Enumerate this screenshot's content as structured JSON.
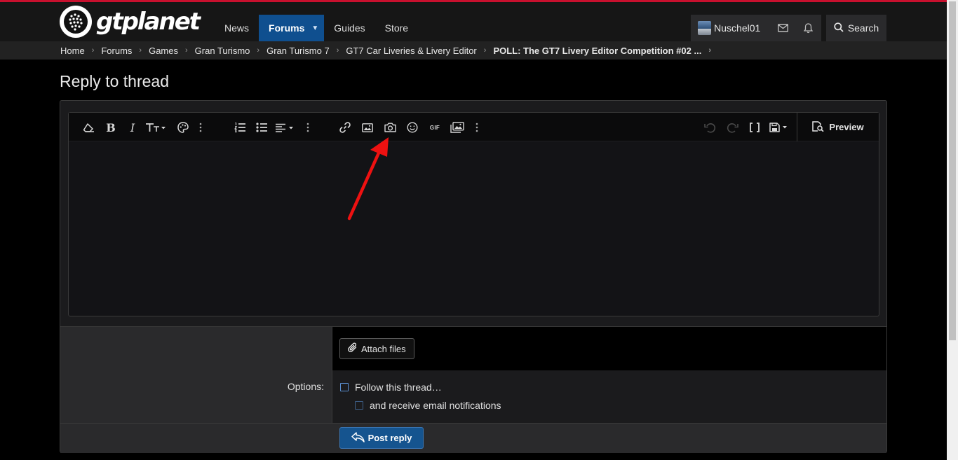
{
  "brand": {
    "name": "gtplanet"
  },
  "colors": {
    "accent_red": "#c8102e",
    "nav_active": "#0f4f8f",
    "button_primary": "#15548f",
    "annotation_arrow": "#ee1111"
  },
  "nav": {
    "items": [
      {
        "label": "News"
      },
      {
        "label": "Forums",
        "active": true
      },
      {
        "label": "Guides"
      },
      {
        "label": "Store"
      }
    ]
  },
  "user": {
    "name": "Nuschel01"
  },
  "search": {
    "label": "Search"
  },
  "breadcrumb": [
    "Home",
    "Forums",
    "Games",
    "Gran Turismo",
    "Gran Turismo 7",
    "GT7 Car Liveries & Livery Editor",
    "POLL: The GT7 Livery Editor Competition #02 ..."
  ],
  "page": {
    "title": "Reply to thread"
  },
  "editor": {
    "toolbar_icons": [
      "eraser-icon",
      "bold-icon",
      "italic-icon",
      "text-size-icon",
      "palette-icon",
      "more-icon",
      "ordered-list-icon",
      "unordered-list-icon",
      "align-icon",
      "more-icon",
      "link-icon",
      "image-icon",
      "camera-icon",
      "smiley-icon",
      "gif-icon",
      "media-icon",
      "more-icon",
      "undo-icon",
      "redo-icon",
      "bbcode-icon",
      "drafts-icon"
    ],
    "gif_label": "GIF",
    "preview_label": "Preview"
  },
  "attach": {
    "label": "Attach files"
  },
  "options": {
    "label": "Options:",
    "follow_label": "Follow this thread…",
    "email_label": "and receive email notifications"
  },
  "submit": {
    "label": "Post reply"
  }
}
